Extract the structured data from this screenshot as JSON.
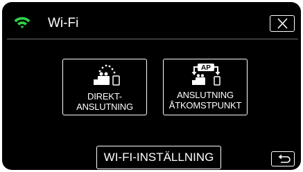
{
  "header": {
    "title": "Wi-Fi",
    "wifi_icon": "wifi-signal-icon",
    "close_icon": "close-x-icon"
  },
  "options": {
    "direct": {
      "line1": "DIREKT-",
      "line2": "ANSLUTNING",
      "icon": "direct-connection-icon"
    },
    "access_point": {
      "line1": "ANSLUTNING",
      "line2": "ÅTKOMSTPUNKT",
      "icon": "access-point-icon",
      "badge": "AP"
    }
  },
  "settings_button": {
    "label": "WI-FI-INSTÄLLNING"
  },
  "back_button": {
    "icon": "return-arrow-icon"
  },
  "colors": {
    "background": "#000000",
    "foreground": "#ffffff",
    "wifi": "#2fd24a",
    "divider": "#6e6e6e"
  }
}
